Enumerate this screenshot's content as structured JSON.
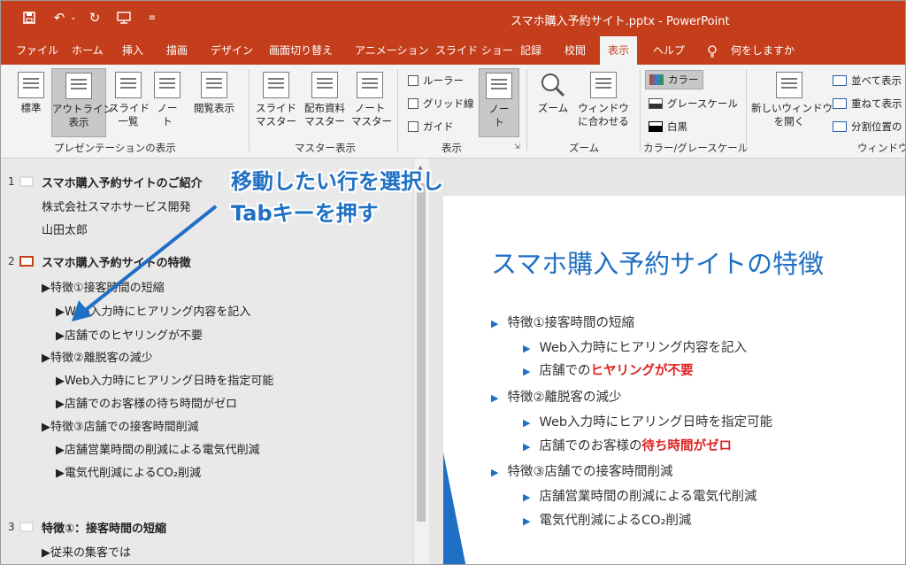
{
  "window": {
    "title": "スマホ購入予約サイト.pptx  -  PowerPoint"
  },
  "quick_access": [
    "save-icon",
    "undo-icon",
    "redo-icon",
    "presenter-icon",
    "customize-icon"
  ],
  "menu": {
    "items": [
      "ファイル",
      "ホーム",
      "挿入",
      "描画",
      "デザイン",
      "画面切り替え",
      "アニメーション",
      "スライド ショー",
      "記録",
      "校閲",
      "表示",
      "ヘルプ",
      "何をしますか"
    ],
    "active": "表示"
  },
  "ribbon": {
    "presentation_views": {
      "label": "プレゼンテーションの表示",
      "buttons": [
        "標準",
        "アウトライン\n表示",
        "スライド\n一覧",
        "ノー\nト",
        "閲覧表示"
      ]
    },
    "master_views": {
      "label": "マスター表示",
      "buttons": [
        "スライド\nマスター",
        "配布資料\nマスター",
        "ノート\nマスター"
      ]
    },
    "show": {
      "label": "表示",
      "checkboxes": [
        "ルーラー",
        "グリッド線",
        "ガイド"
      ],
      "notes_button": "ノー\nト"
    },
    "zoom": {
      "label": "ズーム",
      "buttons": [
        "ズーム",
        "ウィンドウ\nに合わせる"
      ]
    },
    "color": {
      "label": "カラー/グレースケール",
      "options": [
        "カラー",
        "グレースケール",
        "白黒"
      ]
    },
    "window": {
      "label": "ウィンドウ",
      "new_window": "新しいウィンドウ\nを開く",
      "options": [
        "並べて表示",
        "重ねて表示",
        "分割位置の"
      ]
    }
  },
  "outline": {
    "slides": [
      {
        "num": "1",
        "title": "スマホ購入予約サイトのご紹介",
        "lines": [
          "株式会社スマホサービス開発",
          "山田太郎"
        ]
      },
      {
        "num": "2",
        "title": "スマホ購入予約サイトの特徴",
        "lines": [
          "▶特徴①接客時間の短縮",
          "▶Web入力時にヒアリング内容を記入",
          "▶店舗でのヒヤリングが不要",
          "▶特徴②離脱客の減少",
          "▶Web入力時にヒアリング日時を指定可能",
          "▶店舗でのお客様の待ち時間がゼロ",
          "▶特徴③店舗での接客時間削減",
          "▶店舗営業時間の削減による電気代削減",
          "▶電気代削減によるCO₂削減"
        ]
      },
      {
        "num": "3",
        "title": "特徴①：接客時間の短縮",
        "lines": [
          "▶従来の集客では"
        ]
      }
    ]
  },
  "slide": {
    "title": "スマホ購入予約サイトの特徴",
    "bullets": [
      {
        "text": "特徴①接客時間の短縮"
      },
      {
        "text": "Web入力時にヒアリング内容を記入"
      },
      {
        "text": "店舗での",
        "emph": "ヒヤリングが不要"
      },
      {
        "text": "特徴②離脱客の減少"
      },
      {
        "text": "Web入力時にヒアリング日時を指定可能"
      },
      {
        "text": "店舗でのお客様の",
        "emph": "待ち時間がゼロ"
      },
      {
        "text": "特徴③店舗での接客時間削減"
      },
      {
        "text": "店舗営業時間の削減による電気代削減"
      },
      {
        "text": "電気代削減によるCO",
        "suffix": "₂削減"
      }
    ]
  },
  "callout": {
    "line1": "移動したい行を選択し",
    "line2": "Tabキーを押す"
  },
  "colors": {
    "accent": "#c43e1c",
    "slide_blue": "#1f70c4",
    "emphasis_red": "#e02020"
  }
}
